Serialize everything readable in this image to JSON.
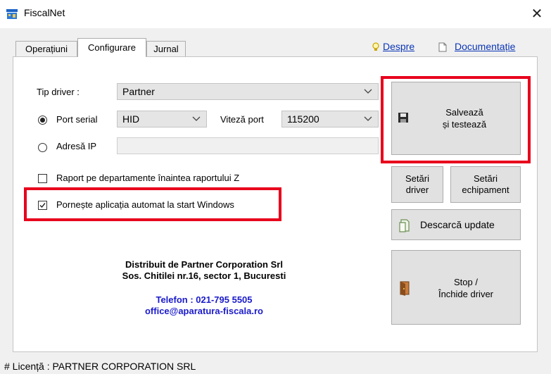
{
  "window": {
    "title": "FiscalNet",
    "close_glyph": "✕"
  },
  "tabs": [
    {
      "label": "Operațiuni",
      "active": false
    },
    {
      "label": "Configurare",
      "active": true
    },
    {
      "label": "Jurnal",
      "active": false
    }
  ],
  "links": {
    "about": "Despre",
    "docs": "Documentație"
  },
  "config": {
    "driver_type_label": "Tip driver :",
    "driver_type_value": "Partner",
    "port_serial_label": "Port serial",
    "port_serial_selected": true,
    "port_value": "HID",
    "baud_label": "Viteză port",
    "baud_value": "115200",
    "ip_label": "Adresă IP",
    "ip_value": "",
    "report_dept_label": "Raport pe departamente înaintea raportului Z",
    "report_dept_checked": false,
    "autostart_label": "Pornește aplicația automat la start Windows",
    "autostart_checked": true
  },
  "buttons": {
    "save_line1": "Salvează",
    "save_line2": "și testează",
    "driver_settings_line1": "Setări",
    "driver_settings_line2": "driver",
    "equip_settings_line1": "Setări",
    "equip_settings_line2": "echipament",
    "download_update": "Descarcă update",
    "stop_line1": "Stop /",
    "stop_line2": "Închide driver"
  },
  "distributor": {
    "line1": "Distribuit de Partner Corporation Srl",
    "line2": "Sos. Chitilei nr.16, sector 1, Bucuresti",
    "phone": "Telefon : 021-795 5505",
    "email": "office@aparatura-fiscala.ro"
  },
  "status_bar": {
    "text": "# Licență : PARTNER CORPORATION SRL"
  },
  "colors": {
    "highlight": "#e8001c",
    "link": "#0a35b5",
    "distributor_contact": "#1a1acc"
  },
  "icons": [
    "app-icon",
    "lightbulb-icon",
    "document-icon",
    "floppy-disk-icon",
    "update-icon",
    "exit-door-icon"
  ]
}
